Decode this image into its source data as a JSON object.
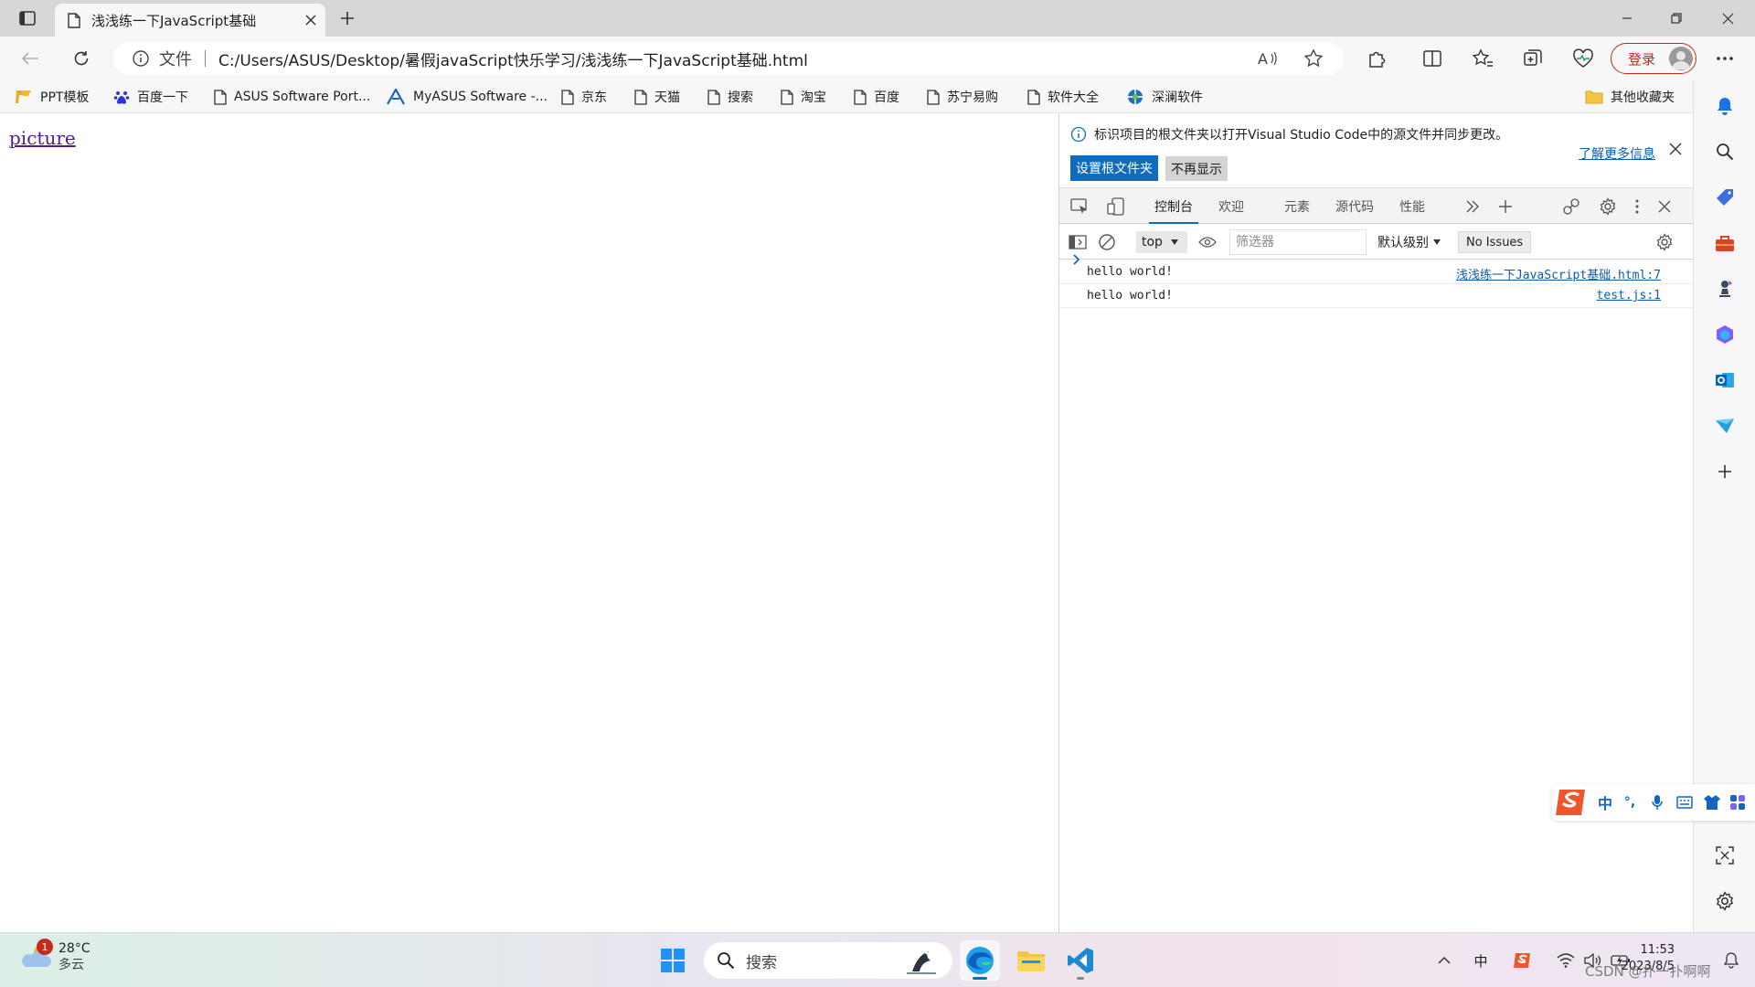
{
  "tab": {
    "title": "浅浅练一下JavaScript基础"
  },
  "address": {
    "file_label": "文件",
    "url": "C:/Users/ASUS/Desktop/暑假javaScript快乐学习/浅浅练一下JavaScript基础.html"
  },
  "login": {
    "label": "登录"
  },
  "favorites": {
    "items": [
      {
        "label": "PPT模板",
        "icon": "ppt-icon"
      },
      {
        "label": "百度一下",
        "icon": "baidu-paw-icon"
      },
      {
        "label": "ASUS Software Port...",
        "icon": "page-icon"
      },
      {
        "label": "MyASUS Software -...",
        "icon": "asus-a-icon"
      },
      {
        "label": "京东",
        "icon": "page-icon"
      },
      {
        "label": "天猫",
        "icon": "page-icon"
      },
      {
        "label": "搜索",
        "icon": "page-icon"
      },
      {
        "label": "淘宝",
        "icon": "page-icon"
      },
      {
        "label": "百度",
        "icon": "page-icon"
      },
      {
        "label": "苏宁易购",
        "icon": "page-icon"
      },
      {
        "label": "软件大全",
        "icon": "page-icon"
      },
      {
        "label": "深澜软件",
        "icon": "srun-icon"
      }
    ],
    "other_label": "其他收藏夹"
  },
  "page": {
    "link_text": "picture"
  },
  "devtools": {
    "info_message": "标识项目的根文件夹以打开Visual Studio Code中的源文件并同步更改。",
    "learn_more": "了解更多信息",
    "set_root_btn": "设置根文件夹",
    "dont_show_btn": "不再显示",
    "tabs": [
      {
        "label": "控制台",
        "active": true
      },
      {
        "label": "欢迎",
        "active": false
      },
      {
        "label": "元素",
        "active": false
      },
      {
        "label": "源代码",
        "active": false
      },
      {
        "label": "性能",
        "active": false
      }
    ],
    "console": {
      "context": "top",
      "filter_placeholder": "筛选器",
      "level": "默认级别",
      "issues": "No Issues",
      "logs": [
        {
          "message": "hello world!",
          "source": "浅浅练一下JavaScript基础.html:7"
        },
        {
          "message": "hello world!",
          "source": "test.js:1"
        }
      ]
    }
  },
  "ime": {
    "mode": "中",
    "punct": "°,"
  },
  "taskbar": {
    "weather": {
      "temp": "28°C",
      "condition": "多云",
      "badge": "1"
    },
    "search_placeholder": "搜索",
    "tray_ime": "中",
    "clock": {
      "time": "11:53",
      "date": "2023/8/5"
    }
  },
  "watermark": "CSDN @扑一扑啊啊",
  "colors": {
    "accent": "#0f6cbd",
    "login_red": "#c42b1c",
    "link_visited": "#551a8b"
  }
}
